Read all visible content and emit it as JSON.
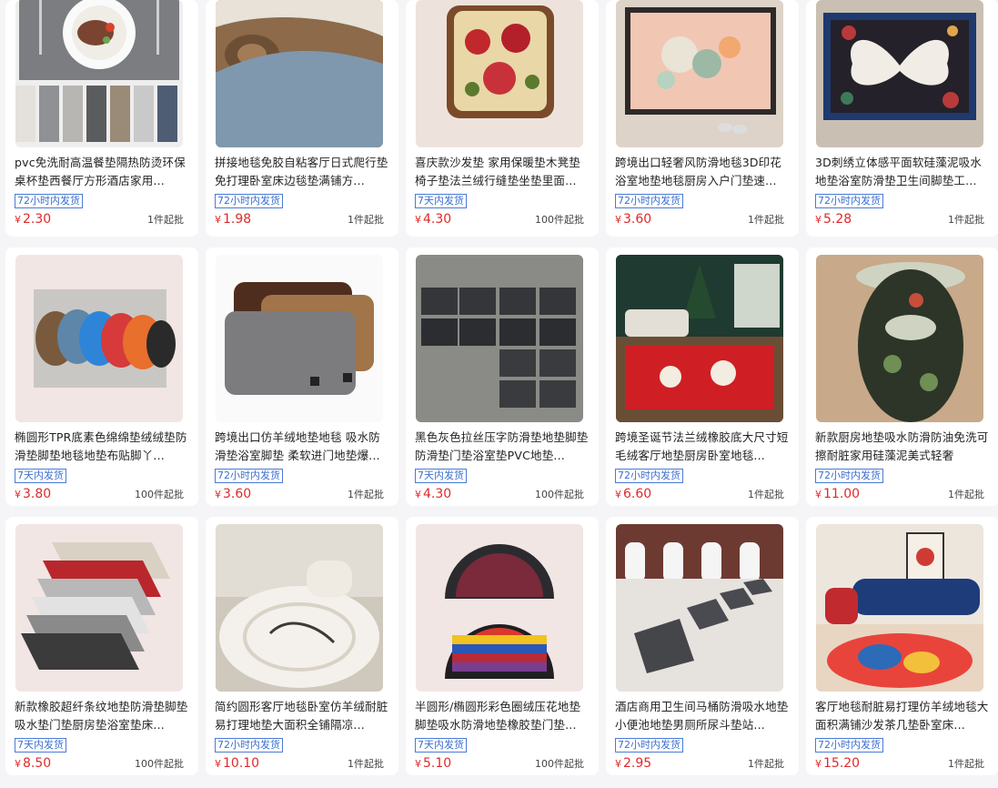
{
  "products": [
    {
      "title": "pvc免洗耐高温餐垫隔热防烫环保桌杯垫西餐厅方形酒店家用...",
      "tag": "72小时内发货",
      "currency": "¥",
      "price": "2.30",
      "moq": "1件起批",
      "image": "gray-placemat-swatches"
    },
    {
      "title": "拼接地毯免胶自粘客厅日式爬行垫免打理卧室床边毯垫满铺方...",
      "tag": "72小时内发货",
      "currency": "¥",
      "price": "1.98",
      "moq": "1件起批",
      "image": "rolled-carpet"
    },
    {
      "title": "喜庆款沙发垫 家用保暖垫木凳垫椅子垫法兰绒行缝垫坐垫里面...",
      "tag": "7天内发货",
      "currency": "¥",
      "price": "4.30",
      "moq": "100件起批",
      "image": "rose-cushion"
    },
    {
      "title": "跨境出口轻奢风防滑地毯3D印花浴室地垫地毯厨房入户门垫速...",
      "tag": "72小时内发货",
      "currency": "¥",
      "price": "3.60",
      "moq": "1件起批",
      "image": "3d-flower-mat"
    },
    {
      "title": "3D刺绣立体感平面软硅藻泥吸水地垫浴室防滑垫卫生间脚垫工...",
      "tag": "72小时内发货",
      "currency": "¥",
      "price": "5.28",
      "moq": "1件起批",
      "image": "butterfly-mat"
    },
    {
      "title": "椭圆形TPR底素色绵绵垫绒绒垫防滑垫脚垫地毯地垫布贴脚丫...",
      "tag": "7天内发货",
      "currency": "¥",
      "price": "3.80",
      "moq": "100件起批",
      "image": "oval-color-mats"
    },
    {
      "title": "跨境出口仿羊绒地垫地毯 吸水防滑垫浴室脚垫 柔软进门地垫爆...",
      "tag": "72小时内发货",
      "currency": "¥",
      "price": "3.60",
      "moq": "1件起批",
      "image": "plush-bath-mats"
    },
    {
      "title": "黑色灰色拉丝压字防滑垫地垫脚垫防滑垫门垫浴室垫PVC地垫...",
      "tag": "7天内发货",
      "currency": "¥",
      "price": "4.30",
      "moq": "100件起批",
      "image": "welcome-mats"
    },
    {
      "title": "跨境圣诞节法兰绒橡胶底大尺寸短毛绒客厅地垫厨房卧室地毯...",
      "tag": "72小时内发货",
      "currency": "¥",
      "price": "6.60",
      "moq": "1件起批",
      "image": "christmas-rug"
    },
    {
      "title": "新款厨房地垫吸水防滑防油免洗可擦耐脏家用硅藻泥美式轻奢",
      "tag": "72小时内发货",
      "currency": "¥",
      "price": "11.00",
      "moq": "1件起批",
      "image": "kitchen-runner"
    },
    {
      "title": "新款橡胶超纤条纹地垫防滑垫脚垫吸水垫门垫厨房垫浴室垫床...",
      "tag": "7天内发货",
      "currency": "¥",
      "price": "8.50",
      "moq": "100件起批",
      "image": "striped-mats"
    },
    {
      "title": "简约圆形客厅地毯卧室仿羊绒耐脏易打理地垫大面积全铺隔凉...",
      "tag": "72小时内发货",
      "currency": "¥",
      "price": "10.10",
      "moq": "1件起批",
      "image": "round-rug"
    },
    {
      "title": "半圆形/椭圆形彩色圈绒压花地垫脚垫吸水防滑地垫橡胶垫门垫...",
      "tag": "7天内发货",
      "currency": "¥",
      "price": "5.10",
      "moq": "100件起批",
      "image": "half-round-mats"
    },
    {
      "title": "酒店商用卫生间马桶防滑吸水地垫小便池地垫男厕所尿斗垫站...",
      "tag": "72小时内发货",
      "currency": "¥",
      "price": "2.95",
      "moq": "1件起批",
      "image": "urinal-mats"
    },
    {
      "title": "客厅地毯耐脏易打理仿羊绒地毯大面积满铺沙发茶几垫卧室床...",
      "tag": "72小时内发货",
      "currency": "¥",
      "price": "15.20",
      "moq": "1件起批",
      "image": "living-room-rug"
    }
  ]
}
